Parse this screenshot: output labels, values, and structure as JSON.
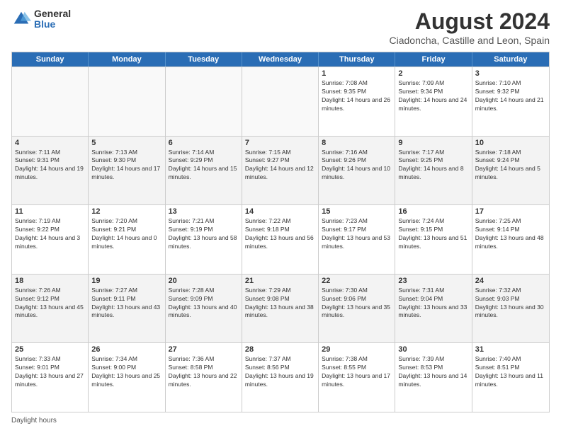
{
  "logo": {
    "general": "General",
    "blue": "Blue"
  },
  "title": "August 2024",
  "subtitle": "Ciadoncha, Castille and Leon, Spain",
  "days": [
    "Sunday",
    "Monday",
    "Tuesday",
    "Wednesday",
    "Thursday",
    "Friday",
    "Saturday"
  ],
  "footer": "Daylight hours",
  "weeks": [
    [
      {
        "day": "",
        "info": ""
      },
      {
        "day": "",
        "info": ""
      },
      {
        "day": "",
        "info": ""
      },
      {
        "day": "",
        "info": ""
      },
      {
        "day": "1",
        "info": "Sunrise: 7:08 AM\nSunset: 9:35 PM\nDaylight: 14 hours and 26 minutes."
      },
      {
        "day": "2",
        "info": "Sunrise: 7:09 AM\nSunset: 9:34 PM\nDaylight: 14 hours and 24 minutes."
      },
      {
        "day": "3",
        "info": "Sunrise: 7:10 AM\nSunset: 9:32 PM\nDaylight: 14 hours and 21 minutes."
      }
    ],
    [
      {
        "day": "4",
        "info": "Sunrise: 7:11 AM\nSunset: 9:31 PM\nDaylight: 14 hours and 19 minutes."
      },
      {
        "day": "5",
        "info": "Sunrise: 7:13 AM\nSunset: 9:30 PM\nDaylight: 14 hours and 17 minutes."
      },
      {
        "day": "6",
        "info": "Sunrise: 7:14 AM\nSunset: 9:29 PM\nDaylight: 14 hours and 15 minutes."
      },
      {
        "day": "7",
        "info": "Sunrise: 7:15 AM\nSunset: 9:27 PM\nDaylight: 14 hours and 12 minutes."
      },
      {
        "day": "8",
        "info": "Sunrise: 7:16 AM\nSunset: 9:26 PM\nDaylight: 14 hours and 10 minutes."
      },
      {
        "day": "9",
        "info": "Sunrise: 7:17 AM\nSunset: 9:25 PM\nDaylight: 14 hours and 8 minutes."
      },
      {
        "day": "10",
        "info": "Sunrise: 7:18 AM\nSunset: 9:24 PM\nDaylight: 14 hours and 5 minutes."
      }
    ],
    [
      {
        "day": "11",
        "info": "Sunrise: 7:19 AM\nSunset: 9:22 PM\nDaylight: 14 hours and 3 minutes."
      },
      {
        "day": "12",
        "info": "Sunrise: 7:20 AM\nSunset: 9:21 PM\nDaylight: 14 hours and 0 minutes."
      },
      {
        "day": "13",
        "info": "Sunrise: 7:21 AM\nSunset: 9:19 PM\nDaylight: 13 hours and 58 minutes."
      },
      {
        "day": "14",
        "info": "Sunrise: 7:22 AM\nSunset: 9:18 PM\nDaylight: 13 hours and 56 minutes."
      },
      {
        "day": "15",
        "info": "Sunrise: 7:23 AM\nSunset: 9:17 PM\nDaylight: 13 hours and 53 minutes."
      },
      {
        "day": "16",
        "info": "Sunrise: 7:24 AM\nSunset: 9:15 PM\nDaylight: 13 hours and 51 minutes."
      },
      {
        "day": "17",
        "info": "Sunrise: 7:25 AM\nSunset: 9:14 PM\nDaylight: 13 hours and 48 minutes."
      }
    ],
    [
      {
        "day": "18",
        "info": "Sunrise: 7:26 AM\nSunset: 9:12 PM\nDaylight: 13 hours and 45 minutes."
      },
      {
        "day": "19",
        "info": "Sunrise: 7:27 AM\nSunset: 9:11 PM\nDaylight: 13 hours and 43 minutes."
      },
      {
        "day": "20",
        "info": "Sunrise: 7:28 AM\nSunset: 9:09 PM\nDaylight: 13 hours and 40 minutes."
      },
      {
        "day": "21",
        "info": "Sunrise: 7:29 AM\nSunset: 9:08 PM\nDaylight: 13 hours and 38 minutes."
      },
      {
        "day": "22",
        "info": "Sunrise: 7:30 AM\nSunset: 9:06 PM\nDaylight: 13 hours and 35 minutes."
      },
      {
        "day": "23",
        "info": "Sunrise: 7:31 AM\nSunset: 9:04 PM\nDaylight: 13 hours and 33 minutes."
      },
      {
        "day": "24",
        "info": "Sunrise: 7:32 AM\nSunset: 9:03 PM\nDaylight: 13 hours and 30 minutes."
      }
    ],
    [
      {
        "day": "25",
        "info": "Sunrise: 7:33 AM\nSunset: 9:01 PM\nDaylight: 13 hours and 27 minutes."
      },
      {
        "day": "26",
        "info": "Sunrise: 7:34 AM\nSunset: 9:00 PM\nDaylight: 13 hours and 25 minutes."
      },
      {
        "day": "27",
        "info": "Sunrise: 7:36 AM\nSunset: 8:58 PM\nDaylight: 13 hours and 22 minutes."
      },
      {
        "day": "28",
        "info": "Sunrise: 7:37 AM\nSunset: 8:56 PM\nDaylight: 13 hours and 19 minutes."
      },
      {
        "day": "29",
        "info": "Sunrise: 7:38 AM\nSunset: 8:55 PM\nDaylight: 13 hours and 17 minutes."
      },
      {
        "day": "30",
        "info": "Sunrise: 7:39 AM\nSunset: 8:53 PM\nDaylight: 13 hours and 14 minutes."
      },
      {
        "day": "31",
        "info": "Sunrise: 7:40 AM\nSunset: 8:51 PM\nDaylight: 13 hours and 11 minutes."
      }
    ]
  ]
}
